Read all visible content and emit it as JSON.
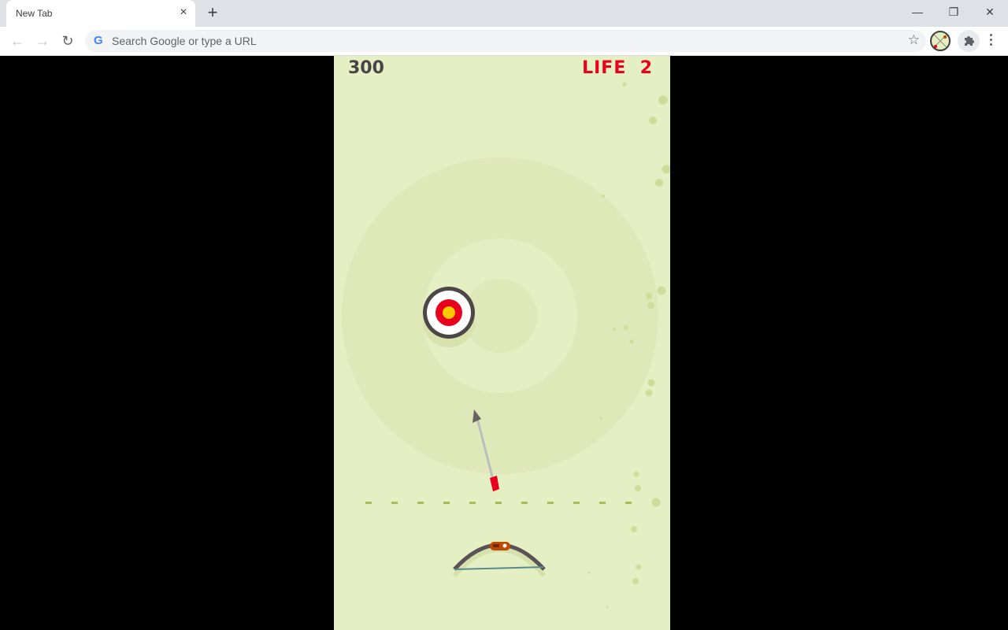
{
  "browser": {
    "tab": {
      "title": "New Tab",
      "close_icon": "×"
    },
    "new_tab_icon": "+",
    "window_controls": {
      "minimize": "—",
      "restore": "❐",
      "close": "✕"
    },
    "nav": {
      "back": "←",
      "forward": "→",
      "reload": "↻"
    },
    "omnibox": {
      "placeholder": "Search Google or type a URL",
      "google_icon": "G",
      "star_icon": "☆"
    }
  },
  "game": {
    "score": "300",
    "life_label": "LIFE",
    "life_value": "2",
    "colors": {
      "background": "#e5efc4",
      "rings": "#dfe8b8",
      "score_text": "#4a4547",
      "life_text": "#e8001c",
      "target_outer": "#4d4748",
      "target_red": "#e8001c",
      "target_center": "#ffc800",
      "dots": "#cfdd9a",
      "dashes": "#a8bd5e",
      "bow": "#5a5254",
      "bow_grip": "#c04a00",
      "bowstring": "#5b8a8c",
      "arrow_shaft": "#bdbdbd",
      "arrow_fletch": "#e8001c"
    }
  }
}
